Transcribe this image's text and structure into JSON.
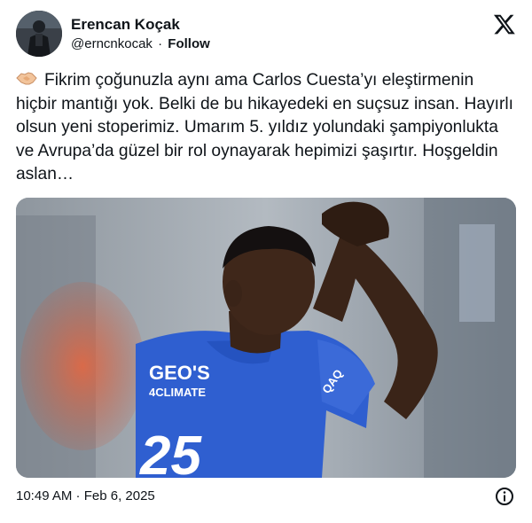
{
  "author": {
    "name": "Erencan Koçak",
    "handle": "@erncnkocak",
    "separator": "·",
    "follow_label": "Follow"
  },
  "tweet": {
    "text": "Fikrim çoğunuzla aynı ama Carlos Cuesta’yı eleştirmenin hiçbir mantığı yok. Belki de bu hikayedeki en suçsuz insan. Hayırlı olsun yeni stoperimiz. Umarım 5. yıldız yolundaki şampiyonlukta ve Avrupa’da güzel bir rol oynayarak hepimizi şaşırtır. Hoşgeldin aslan…",
    "emoji_icon": "handshake-emoji"
  },
  "media": {
    "jersey_sponsor": "GEO'S",
    "jersey_sub": "4CLIMATE",
    "sleeve_badge": "QAQ",
    "number": "25"
  },
  "footer": {
    "timestamp": "10:49 AM · Feb 6, 2025"
  },
  "icons": {
    "brand": "x-logo-icon",
    "info": "info-icon"
  },
  "colors": {
    "text": "#0f1419",
    "jersey": "#2f5fd0",
    "background": "#ffffff"
  }
}
